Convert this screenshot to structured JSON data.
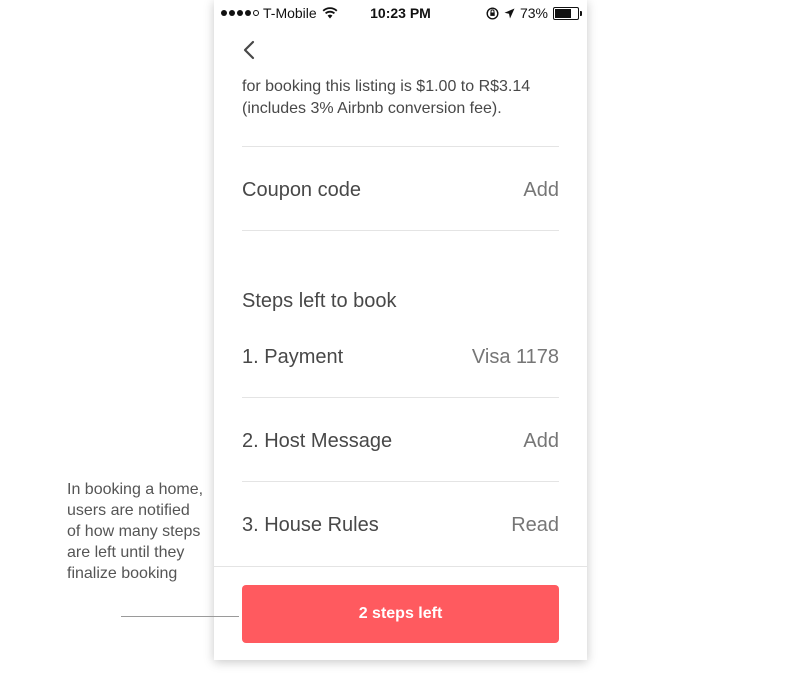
{
  "status_bar": {
    "carrier": "T-Mobile",
    "time": "10:23 PM",
    "battery": "73%",
    "battery_level": 0.73,
    "icons": [
      "signal-dots-icon",
      "wifi-icon",
      "rotation-lock-icon",
      "location-arrow-icon",
      "battery-icon"
    ]
  },
  "nav": {
    "back_icon": "chevron-left-icon"
  },
  "price_note": {
    "text": "for booking this listing is $1.00 to R$3.14 (includes 3% Airbnb conversion fee)."
  },
  "coupon": {
    "label": "Coupon code",
    "action": "Add"
  },
  "steps_section": {
    "title": "Steps left to book",
    "steps": [
      {
        "label": "1. Payment",
        "value": "Visa 1178"
      },
      {
        "label": "2. Host Message",
        "value": "Add"
      },
      {
        "label": "3. House Rules",
        "value": "Read"
      }
    ]
  },
  "cta": {
    "label": "2 steps left",
    "color": "#ff5a5f"
  },
  "annotation": {
    "text": "In booking a home, users are notified of how many steps are left until they finalize booking"
  }
}
